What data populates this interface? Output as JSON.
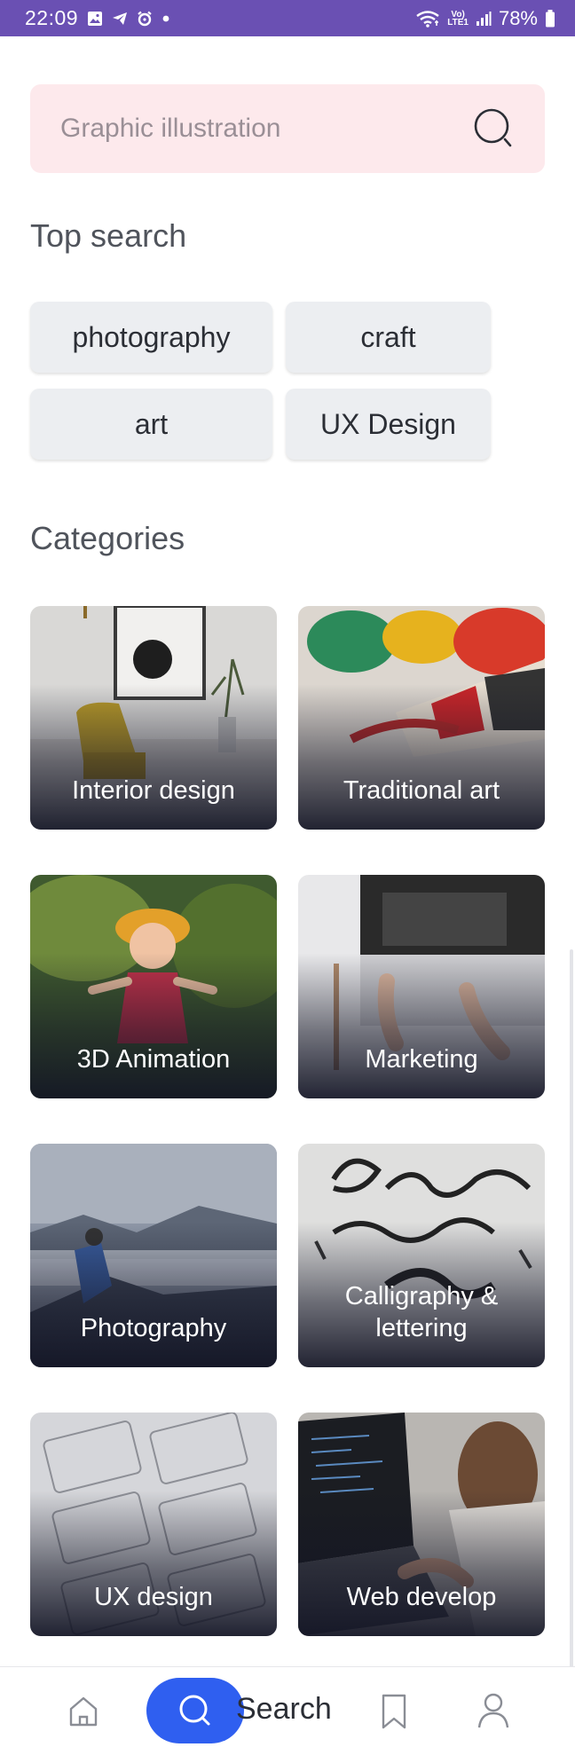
{
  "status_bar": {
    "time": "22:09",
    "lte_top": "Vo)",
    "lte_bottom": "LTE1",
    "battery": "78%",
    "color": "#6a50b3"
  },
  "search": {
    "placeholder": "Graphic illustration",
    "icon": "search-icon"
  },
  "top_search": {
    "title": "Top search",
    "chips": [
      "photography",
      "craft",
      "art",
      "UX Design"
    ]
  },
  "categories": {
    "title": "Categories",
    "items": [
      {
        "label": "Interior design"
      },
      {
        "label": "Traditional art"
      },
      {
        "label": "3D Animation"
      },
      {
        "label": "Marketing"
      },
      {
        "label": "Photography"
      },
      {
        "label": "Calligraphy & lettering"
      },
      {
        "label": "UX design"
      },
      {
        "label": "Web develop"
      }
    ]
  },
  "bottom_nav": {
    "items": [
      "home-icon",
      "search-icon",
      "bookmark-icon",
      "profile-icon"
    ],
    "active_label": "Search",
    "accent": "#2f5ff0"
  }
}
